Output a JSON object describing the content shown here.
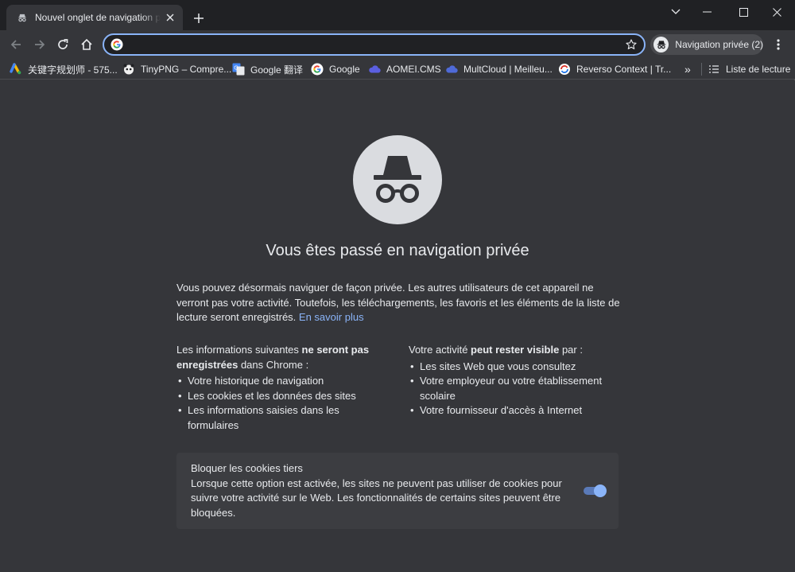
{
  "colors": {
    "accent": "#8ab4f8",
    "background": "#35363a",
    "tabstrip": "#202124",
    "text": "#e8eaed"
  },
  "tab": {
    "title": "Nouvel onglet de navigation privée",
    "favicon": "incognito-icon",
    "close_icon": "close-icon"
  },
  "window_controls": {
    "minimize": "minimize-icon",
    "maximize": "maximize-icon",
    "close": "close-icon",
    "tab_search": "chevron-down-icon"
  },
  "toolbar": {
    "back": "arrow-left-icon",
    "forward": "arrow-right-icon",
    "reload": "reload-icon",
    "home": "home-icon",
    "omnibox_value": "",
    "star": "star-icon",
    "profile_label": "Navigation privée (2)",
    "menu": "more-vert-icon"
  },
  "bookmarks": [
    {
      "label": "关键字规划师 - 575...",
      "icon": "google-ads-icon"
    },
    {
      "label": "TinyPNG – Compre...",
      "icon": "panda-icon"
    },
    {
      "label": "Google 翻译",
      "icon": "google-translate-icon"
    },
    {
      "label": "Google",
      "icon": "google-icon"
    },
    {
      "label": "AOMEI.CMS",
      "icon": "cloud-icon"
    },
    {
      "label": "MultCloud | Meilleu...",
      "icon": "cloud-icon"
    },
    {
      "label": "Reverso Context | Tr...",
      "icon": "reverso-icon"
    }
  ],
  "bookmarks_overflow": "»",
  "reading_list": {
    "label": "Liste de lecture",
    "icon": "reading-list-icon"
  },
  "content": {
    "heading": "Vous êtes passé en navigation privée",
    "intro": "Vous pouvez désormais naviguer de façon privée. Les autres utilisateurs de cet appareil ne verront pas votre activité. Toutefois, les téléchargements, les favoris et les éléments de la liste de lecture seront enregistrés.",
    "learn_more": "En savoir plus",
    "left_heading_pre": "Les informations suivantes ",
    "left_heading_bold": "ne seront pas enregistrées",
    "left_heading_post": " dans Chrome :",
    "left_items": [
      "Votre historique de navigation",
      "Les cookies et les données des sites",
      "Les informations saisies dans les formulaires"
    ],
    "right_heading_pre": "Votre activité ",
    "right_heading_bold": "peut rester visible",
    "right_heading_post": " par :",
    "right_items": [
      "Les sites Web que vous consultez",
      "Votre employeur ou votre établissement scolaire",
      "Votre fournisseur d'accès à Internet"
    ],
    "cookie_title": "Bloquer les cookies tiers",
    "cookie_text": "Lorsque cette option est activée, les sites ne peuvent pas utiliser de cookies pour suivre votre activité sur le Web. Les fonctionnalités de certains sites peuvent être bloquées.",
    "cookie_toggle_on": true
  }
}
